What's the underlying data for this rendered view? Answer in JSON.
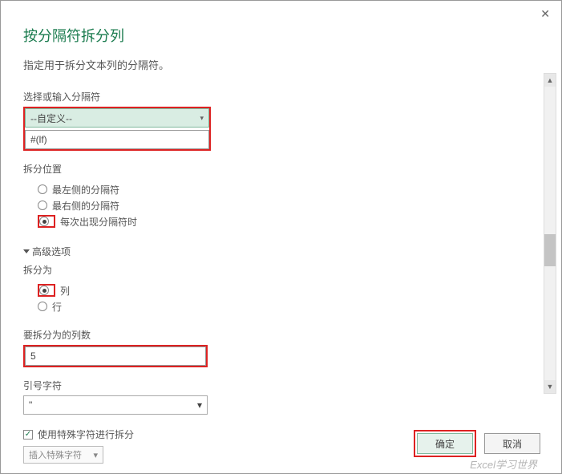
{
  "close_glyph": "✕",
  "title": "按分隔符拆分列",
  "subtitle": "指定用于拆分文本列的分隔符。",
  "delimiter": {
    "label": "选择或输入分隔符",
    "select_value": "--自定义--",
    "input_value": "#(lf)"
  },
  "split_position": {
    "label": "拆分位置",
    "opt_left": "最左侧的分隔符",
    "opt_right": "最右侧的分隔符",
    "opt_each": "每次出现分隔符时",
    "selected": "each"
  },
  "advanced_header": "高级选项",
  "split_to": {
    "label": "拆分为",
    "opt_columns": "列",
    "opt_rows": "行",
    "selected": "columns"
  },
  "col_count": {
    "label": "要拆分为的列数",
    "value": "5"
  },
  "quote": {
    "label": "引号字符",
    "value": "\""
  },
  "special": {
    "checkbox_label": "使用特殊字符进行拆分",
    "checked": true,
    "insert_label": "插入特殊字符"
  },
  "buttons": {
    "ok": "确定",
    "cancel": "取消"
  },
  "watermark": "Excel学习世界"
}
